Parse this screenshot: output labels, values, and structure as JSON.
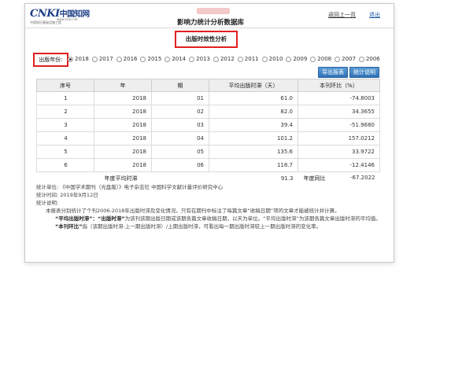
{
  "header": {
    "logo_mark": "CNKI",
    "logo_cn": "中国知网",
    "logo_url": "www.cnki.net",
    "logo_sub": "中国知识基础设施工程",
    "db_title": "影响力统计分析数据库",
    "back_label": "返回上一页",
    "logout_label": "退出"
  },
  "section_title": "出版时效性分析",
  "year_filter": {
    "label": "出版年份:",
    "selected": "2018",
    "years": [
      "2018",
      "2017",
      "2016",
      "2015",
      "2014",
      "2013",
      "2012",
      "2011",
      "2010",
      "2009",
      "2008",
      "2007",
      "2006"
    ]
  },
  "toolbar": {
    "export_label": "导出报表",
    "desc_label": "统计说明"
  },
  "table": {
    "headers": [
      "序号",
      "年",
      "期",
      "平均出版时滞（天）",
      "本刊环比（%）"
    ],
    "rows": [
      [
        "1",
        "2018",
        "01",
        "61.0",
        "-74.8003"
      ],
      [
        "2",
        "2018",
        "02",
        "82.0",
        "34.3655"
      ],
      [
        "3",
        "2018",
        "03",
        "39.4",
        "-51.9680"
      ],
      [
        "4",
        "2018",
        "04",
        "101.2",
        "157.0212"
      ],
      [
        "5",
        "2018",
        "05",
        "135.6",
        "33.9722"
      ],
      [
        "6",
        "2018",
        "06",
        "118.7",
        "-12.4146"
      ]
    ],
    "summary": {
      "avg_label": "年度平均时滞",
      "avg_value": "91.3",
      "yoy_label": "年度同比",
      "yoy_value": "-67.2022"
    }
  },
  "notes": {
    "unit": "统计单位: 《中国学术期刊（光盘版）》电子杂志社 中国科学文献计量评价研究中心",
    "time": "统计时间: 2019年9月12日",
    "desc_title": "统计说明:",
    "desc1": "本报表分别统计了个刊2006-2018年出版时滞及变化情况。只有在期刊中标注了每篇文章“收稿日期”项的文章才能被统计并计算。",
    "desc2_term": "“平均出版时滞”：“出版时滞”",
    "desc2": "为该刊该期出版日期或该期各篇文章收稿日期，以天为单位。“平均出版时滞”为该期各篇文章出版时滞的平均值。",
    "desc3_term": "“本刊环比”",
    "desc3": "指（该期出版时滞-上一期出版时滞）/上期出版时滞，可看出每一期出版时滞较上一期出版时滞的变化率。"
  }
}
